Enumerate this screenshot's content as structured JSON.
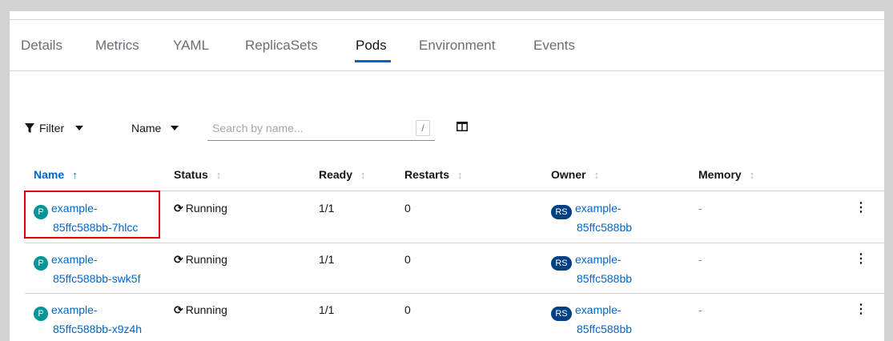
{
  "tabs": [
    {
      "label": "Details",
      "active": false
    },
    {
      "label": "Metrics",
      "active": false
    },
    {
      "label": "YAML",
      "active": false
    },
    {
      "label": "ReplicaSets",
      "active": false
    },
    {
      "label": "Pods",
      "active": true
    },
    {
      "label": "Environment",
      "active": false
    },
    {
      "label": "Events",
      "active": false
    }
  ],
  "toolbar": {
    "filter_label": "Filter",
    "name_select_label": "Name",
    "search_placeholder": "Search by name...",
    "search_shortcut": "/"
  },
  "table": {
    "headers": [
      "Name",
      "Status",
      "Ready",
      "Restarts",
      "Owner",
      "Memory"
    ],
    "rows": [
      {
        "badge": "P",
        "name_line1": "example-",
        "name_line2": "85ffc588bb-7hlcc",
        "status": "Running",
        "ready": "1/1",
        "restarts": "0",
        "owner_badge": "RS",
        "owner_line1": "example-",
        "owner_line2": "85ffc588bb",
        "memory": "-"
      },
      {
        "badge": "P",
        "name_line1": "example-",
        "name_line2": "85ffc588bb-swk5f",
        "status": "Running",
        "ready": "1/1",
        "restarts": "0",
        "owner_badge": "RS",
        "owner_line1": "example-",
        "owner_line2": "85ffc588bb",
        "memory": "-"
      },
      {
        "badge": "P",
        "name_line1": "example-",
        "name_line2": "85ffc588bb-x9z4h",
        "status": "Running",
        "ready": "1/1",
        "restarts": "0",
        "owner_badge": "RS",
        "owner_line1": "example-",
        "owner_line2": "85ffc588bb",
        "memory": "-"
      }
    ]
  },
  "colors": {
    "accent": "#0066cc",
    "pod_badge": "#009596",
    "rs_badge": "#004080",
    "highlight": "#e00000"
  }
}
